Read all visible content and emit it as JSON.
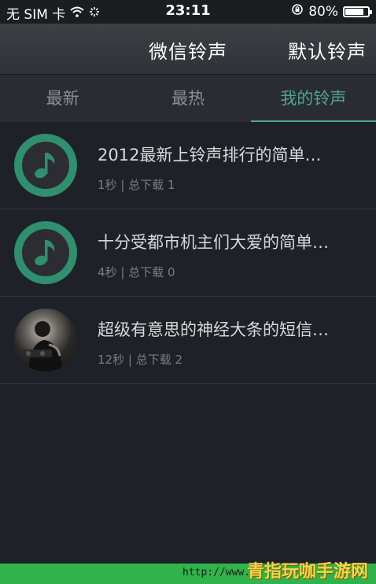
{
  "status_bar": {
    "carrier": "无 SIM 卡",
    "time": "23:11",
    "battery": "80%",
    "battery_level": 0.8
  },
  "nav": {
    "title": "微信铃声",
    "action_label": "默认铃声"
  },
  "tabs": [
    {
      "label": "最新",
      "active": false
    },
    {
      "label": "最热",
      "active": false
    },
    {
      "label": "我的铃声",
      "active": true
    }
  ],
  "ringtones": [
    {
      "title": "2012最新上铃声排行的简单…",
      "duration": "1秒",
      "separator": "|",
      "downloads": "总下载 1",
      "icon": "music-note-icon"
    },
    {
      "title": "十分受都市机主们大爱的简单…",
      "duration": "4秒",
      "separator": "|",
      "downloads": "总下载 0",
      "icon": "music-note-icon"
    },
    {
      "title": "超级有意思的神经大条的短信…",
      "duration": "12秒",
      "separator": "|",
      "downloads": "总下载 2",
      "icon": "dj-photo"
    }
  ],
  "bottom": {
    "url": "http://www.h",
    "watermark": "青指玩咖手游网"
  },
  "colors": {
    "accent": "#4ea58a",
    "icon_ring": "#2f8f6e",
    "background": "#1f2128",
    "bottom_band": "#2fb34a"
  }
}
